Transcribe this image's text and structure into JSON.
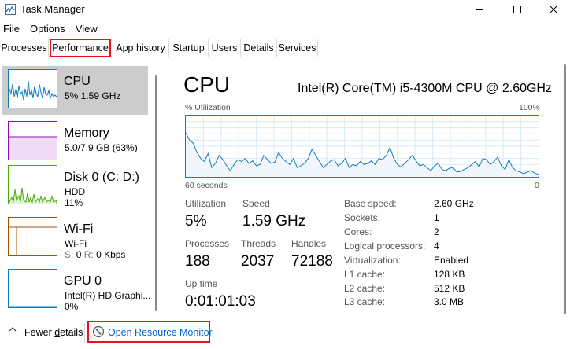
{
  "window": {
    "title": "Task Manager",
    "icon": "task-manager-icon"
  },
  "menu": [
    "File",
    "Options",
    "View"
  ],
  "tabs": [
    "Processes",
    "Performance",
    "App history",
    "Startup",
    "Users",
    "Details",
    "Services"
  ],
  "active_tab": "Performance",
  "resources": [
    {
      "name": "CPU",
      "line1": "5%  1.59 GHz",
      "line2": "",
      "line3": "",
      "color": "#117dbb"
    },
    {
      "name": "Memory",
      "line1": "5.0/7.9 GB (63%)",
      "line2": "",
      "line3": "",
      "color": "#8b12ae"
    },
    {
      "name": "Disk 0 (C: D:)",
      "line1": "HDD",
      "line2": "11%",
      "line3": "",
      "color": "#4da60c"
    },
    {
      "name": "Wi-Fi",
      "line1": "Wi-Fi",
      "line2_s": "S:",
      "line2_s_val": "0",
      "line2_r": "R:",
      "line2_r_val": "0 Kbps",
      "color": "#a74f01"
    },
    {
      "name": "GPU 0",
      "line1": "Intel(R) HD Graphi...",
      "line2": "0%",
      "line3": "",
      "color": "#117dbb"
    }
  ],
  "main": {
    "title": "CPU",
    "cpu_name": "Intel(R) Core(TM) i5-4300M CPU @ 2.60GHz",
    "graph_label": "% Utilization",
    "graph_max": "100%",
    "graph_time": "60 seconds",
    "graph_min": "0",
    "graph_color": "#117dbb",
    "utilization_series": [
      72,
      60,
      55,
      40,
      30,
      25,
      38,
      15,
      22,
      35,
      28,
      18,
      10,
      20,
      28,
      25,
      30,
      22,
      26,
      18,
      20,
      35,
      28,
      22,
      24,
      40,
      30,
      25,
      20,
      30,
      15,
      18,
      22,
      30,
      45,
      35,
      25,
      15,
      20,
      26,
      28,
      18,
      22,
      30,
      15,
      20,
      18,
      25,
      20,
      22,
      26,
      20,
      30,
      28,
      35,
      48,
      30,
      20,
      16,
      22,
      28,
      35,
      26,
      18,
      20,
      15,
      10,
      18,
      22,
      12,
      10,
      14,
      15,
      8,
      9,
      12,
      15,
      20,
      25,
      16,
      30,
      28,
      20,
      25,
      32,
      18,
      12,
      28,
      15,
      10,
      8,
      5,
      8,
      10,
      6,
      4
    ]
  },
  "stats": {
    "utilization": {
      "label": "Utilization",
      "value": "5%"
    },
    "speed": {
      "label": "Speed",
      "value": "1.59 GHz"
    },
    "processes": {
      "label": "Processes",
      "value": "188"
    },
    "threads": {
      "label": "Threads",
      "value": "2037"
    },
    "handles": {
      "label": "Handles",
      "value": "72188"
    },
    "uptime": {
      "label": "Up time",
      "value": "0:01:01:03"
    }
  },
  "specs": [
    {
      "label": "Base speed:",
      "value": "2.60 GHz"
    },
    {
      "label": "Sockets:",
      "value": "1"
    },
    {
      "label": "Cores:",
      "value": "2"
    },
    {
      "label": "Logical processors:",
      "value": "4"
    },
    {
      "label": "Virtualization:",
      "value": "Enabled"
    },
    {
      "label": "L1 cache:",
      "value": "128 KB"
    },
    {
      "label": "L2 cache:",
      "value": "512 KB"
    },
    {
      "label": "L3 cache:",
      "value": "3.0 MB"
    }
  ],
  "footer": {
    "fewer_details_prefix": "Fewer ",
    "fewer_details_underlined": "d",
    "fewer_details_suffix": "etails",
    "open_resource_monitor": "Open Resource Monitor"
  },
  "colors": {
    "highlight_red": "#e8121b",
    "link": "#0066cc",
    "selected_bg": "#cccccc"
  }
}
